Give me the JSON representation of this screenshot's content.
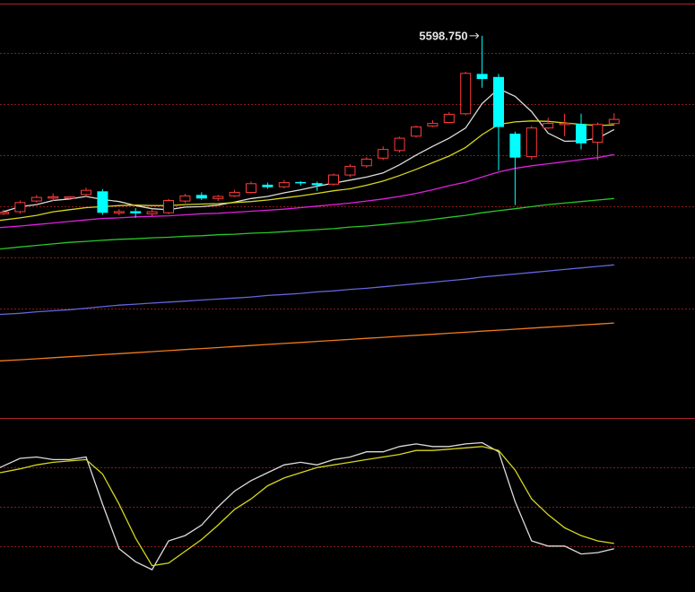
{
  "chart_data": [
    {
      "type": "candlestick",
      "panel": "price",
      "ylim": [
        4850,
        5660
      ],
      "grid_levels": [
        5565,
        5465,
        5365,
        5265,
        5165,
        5065
      ],
      "high_annotation": {
        "value": 5598.75,
        "text": "5598.750"
      },
      "candles": [
        {
          "o": 5250,
          "c": 5253,
          "h": 5258,
          "l": 5248
        },
        {
          "o": 5254,
          "c": 5272,
          "h": 5276,
          "l": 5250
        },
        {
          "o": 5275,
          "c": 5282,
          "h": 5287,
          "l": 5272
        },
        {
          "o": 5282,
          "c": 5282,
          "h": 5290,
          "l": 5275
        },
        {
          "o": 5282,
          "c": 5282,
          "h": 5284,
          "l": 5279
        },
        {
          "o": 5288,
          "c": 5296,
          "h": 5301,
          "l": 5283
        },
        {
          "o": 5294,
          "c": 5252,
          "h": 5298,
          "l": 5248
        },
        {
          "o": 5252,
          "c": 5253,
          "h": 5259,
          "l": 5247
        },
        {
          "o": 5255,
          "c": 5251,
          "h": 5261,
          "l": 5242
        },
        {
          "o": 5250,
          "c": 5254,
          "h": 5258,
          "l": 5246
        },
        {
          "o": 5252,
          "c": 5276,
          "h": 5279,
          "l": 5249
        },
        {
          "o": 5275,
          "c": 5285,
          "h": 5289,
          "l": 5271
        },
        {
          "o": 5287,
          "c": 5280,
          "h": 5292,
          "l": 5277
        },
        {
          "o": 5280,
          "c": 5284,
          "h": 5287,
          "l": 5275
        },
        {
          "o": 5285,
          "c": 5292,
          "h": 5297,
          "l": 5283
        },
        {
          "o": 5292,
          "c": 5309,
          "h": 5313,
          "l": 5290
        },
        {
          "o": 5307,
          "c": 5302,
          "h": 5311,
          "l": 5299
        },
        {
          "o": 5303,
          "c": 5311,
          "h": 5316,
          "l": 5300
        },
        {
          "o": 5311,
          "c": 5309,
          "h": 5314,
          "l": 5305
        },
        {
          "o": 5310,
          "c": 5306,
          "h": 5313,
          "l": 5295
        },
        {
          "o": 5308,
          "c": 5326,
          "h": 5329,
          "l": 5305
        },
        {
          "o": 5326,
          "c": 5343,
          "h": 5347,
          "l": 5322
        },
        {
          "o": 5344,
          "c": 5357,
          "h": 5361,
          "l": 5340
        },
        {
          "o": 5359,
          "c": 5376,
          "h": 5382,
          "l": 5355
        },
        {
          "o": 5374,
          "c": 5398,
          "h": 5401,
          "l": 5370
        },
        {
          "o": 5402,
          "c": 5420,
          "h": 5423,
          "l": 5399
        },
        {
          "o": 5422,
          "c": 5427,
          "h": 5433,
          "l": 5420
        },
        {
          "o": 5429,
          "c": 5445,
          "h": 5449,
          "l": 5427
        },
        {
          "o": 5446,
          "c": 5525,
          "h": 5528,
          "l": 5443
        },
        {
          "o": 5524,
          "c": 5514,
          "h": 5598.75,
          "l": 5497
        },
        {
          "o": 5518,
          "c": 5420,
          "h": 5524,
          "l": 5335
        },
        {
          "o": 5407,
          "c": 5360,
          "h": 5411,
          "l": 5267
        },
        {
          "o": 5362,
          "c": 5418,
          "h": 5422,
          "l": 5356
        },
        {
          "o": 5418,
          "c": 5427,
          "h": 5438,
          "l": 5416
        },
        {
          "o": 5426,
          "c": 5426,
          "h": 5446,
          "l": 5402
        },
        {
          "o": 5426,
          "c": 5388,
          "h": 5446,
          "l": 5376
        },
        {
          "o": 5390,
          "c": 5425,
          "h": 5429,
          "l": 5355
        },
        {
          "o": 5427,
          "c": 5435,
          "h": 5447,
          "l": 5423
        }
      ],
      "ma_lines": [
        {
          "color": "#dcdcdc",
          "values": [
            5252,
            5264,
            5268,
            5276,
            5279,
            5284,
            5278,
            5274,
            5266,
            5260,
            5258,
            5263,
            5264,
            5267,
            5273,
            5280,
            5284,
            5291,
            5297,
            5304,
            5310,
            5316,
            5322,
            5330,
            5346,
            5365,
            5382,
            5398,
            5418,
            5466,
            5495,
            5480,
            5450,
            5408,
            5392,
            5393,
            5398,
            5415
          ]
        },
        {
          "color": "#d6d61e",
          "values": [
            5237,
            5242,
            5247,
            5254,
            5258,
            5262,
            5264,
            5266,
            5267,
            5266,
            5266,
            5268,
            5269,
            5270,
            5272,
            5274,
            5277,
            5281,
            5285,
            5290,
            5295,
            5299,
            5306,
            5314,
            5325,
            5337,
            5350,
            5363,
            5380,
            5405,
            5425,
            5430,
            5432,
            5431,
            5428,
            5425,
            5423,
            5424
          ]
        },
        {
          "color": "#e020e0",
          "values": [
            5223,
            5226,
            5229,
            5232,
            5235,
            5238,
            5241,
            5242,
            5244,
            5245,
            5246,
            5248,
            5250,
            5251,
            5253,
            5255,
            5257,
            5259,
            5262,
            5265,
            5268,
            5271,
            5275,
            5279,
            5284,
            5290,
            5297,
            5305,
            5312,
            5322,
            5332,
            5339,
            5344,
            5348,
            5352,
            5356,
            5360,
            5366
          ]
        },
        {
          "color": "#28c828",
          "values": [
            5181,
            5185,
            5188,
            5191,
            5194,
            5196,
            5198,
            5200,
            5201,
            5203,
            5204,
            5206,
            5207,
            5209,
            5210,
            5212,
            5213,
            5215,
            5217,
            5219,
            5221,
            5224,
            5226,
            5229,
            5232,
            5235,
            5239,
            5243,
            5247,
            5252,
            5256,
            5260,
            5264,
            5268,
            5271,
            5274,
            5277,
            5280
          ]
        },
        {
          "color": "#6464dc",
          "values": [
            5053,
            5055,
            5058,
            5060,
            5062,
            5065,
            5068,
            5071,
            5073,
            5075,
            5077,
            5079,
            5081,
            5083,
            5085,
            5087,
            5090,
            5092,
            5094,
            5097,
            5099,
            5102,
            5104,
            5107,
            5110,
            5113,
            5116,
            5119,
            5122,
            5126,
            5129,
            5132,
            5135,
            5138,
            5141,
            5144,
            5147,
            5150
          ]
        },
        {
          "color": "#f07a1e",
          "values": [
            4962,
            4964,
            4966,
            4968,
            4970,
            4972,
            4974,
            4976,
            4978,
            4980,
            4982,
            4984,
            4986,
            4988,
            4990,
            4992,
            4994,
            4996,
            4998,
            5000,
            5002,
            5004,
            5006,
            5008,
            5010,
            5012,
            5014,
            5016,
            5018,
            5020,
            5022,
            5024,
            5026,
            5028,
            5030,
            5032,
            5034,
            5036
          ]
        }
      ]
    },
    {
      "type": "line",
      "panel": "oscillator",
      "ylim": [
        0,
        100
      ],
      "grid_levels": [
        80,
        50,
        20
      ],
      "series": [
        {
          "color": "#dcdcdc",
          "values": [
            80,
            87,
            88,
            86,
            86,
            88,
            52,
            18,
            8,
            2,
            24,
            28,
            36,
            50,
            62,
            70,
            76,
            82,
            84,
            82,
            86,
            88,
            92,
            92,
            96,
            98,
            96,
            96,
            98,
            99,
            92,
            54,
            24,
            20,
            20,
            14,
            15,
            18
          ]
        },
        {
          "color": "#d6d61e",
          "values": [
            76,
            79,
            82,
            84,
            85,
            86,
            75,
            52,
            26,
            5,
            7,
            16,
            25,
            36,
            48,
            56,
            66,
            72,
            76,
            80,
            82,
            84,
            86,
            88,
            90,
            93,
            93,
            94,
            95,
            96,
            93,
            78,
            56,
            44,
            34,
            28,
            24,
            22
          ]
        }
      ]
    }
  ]
}
